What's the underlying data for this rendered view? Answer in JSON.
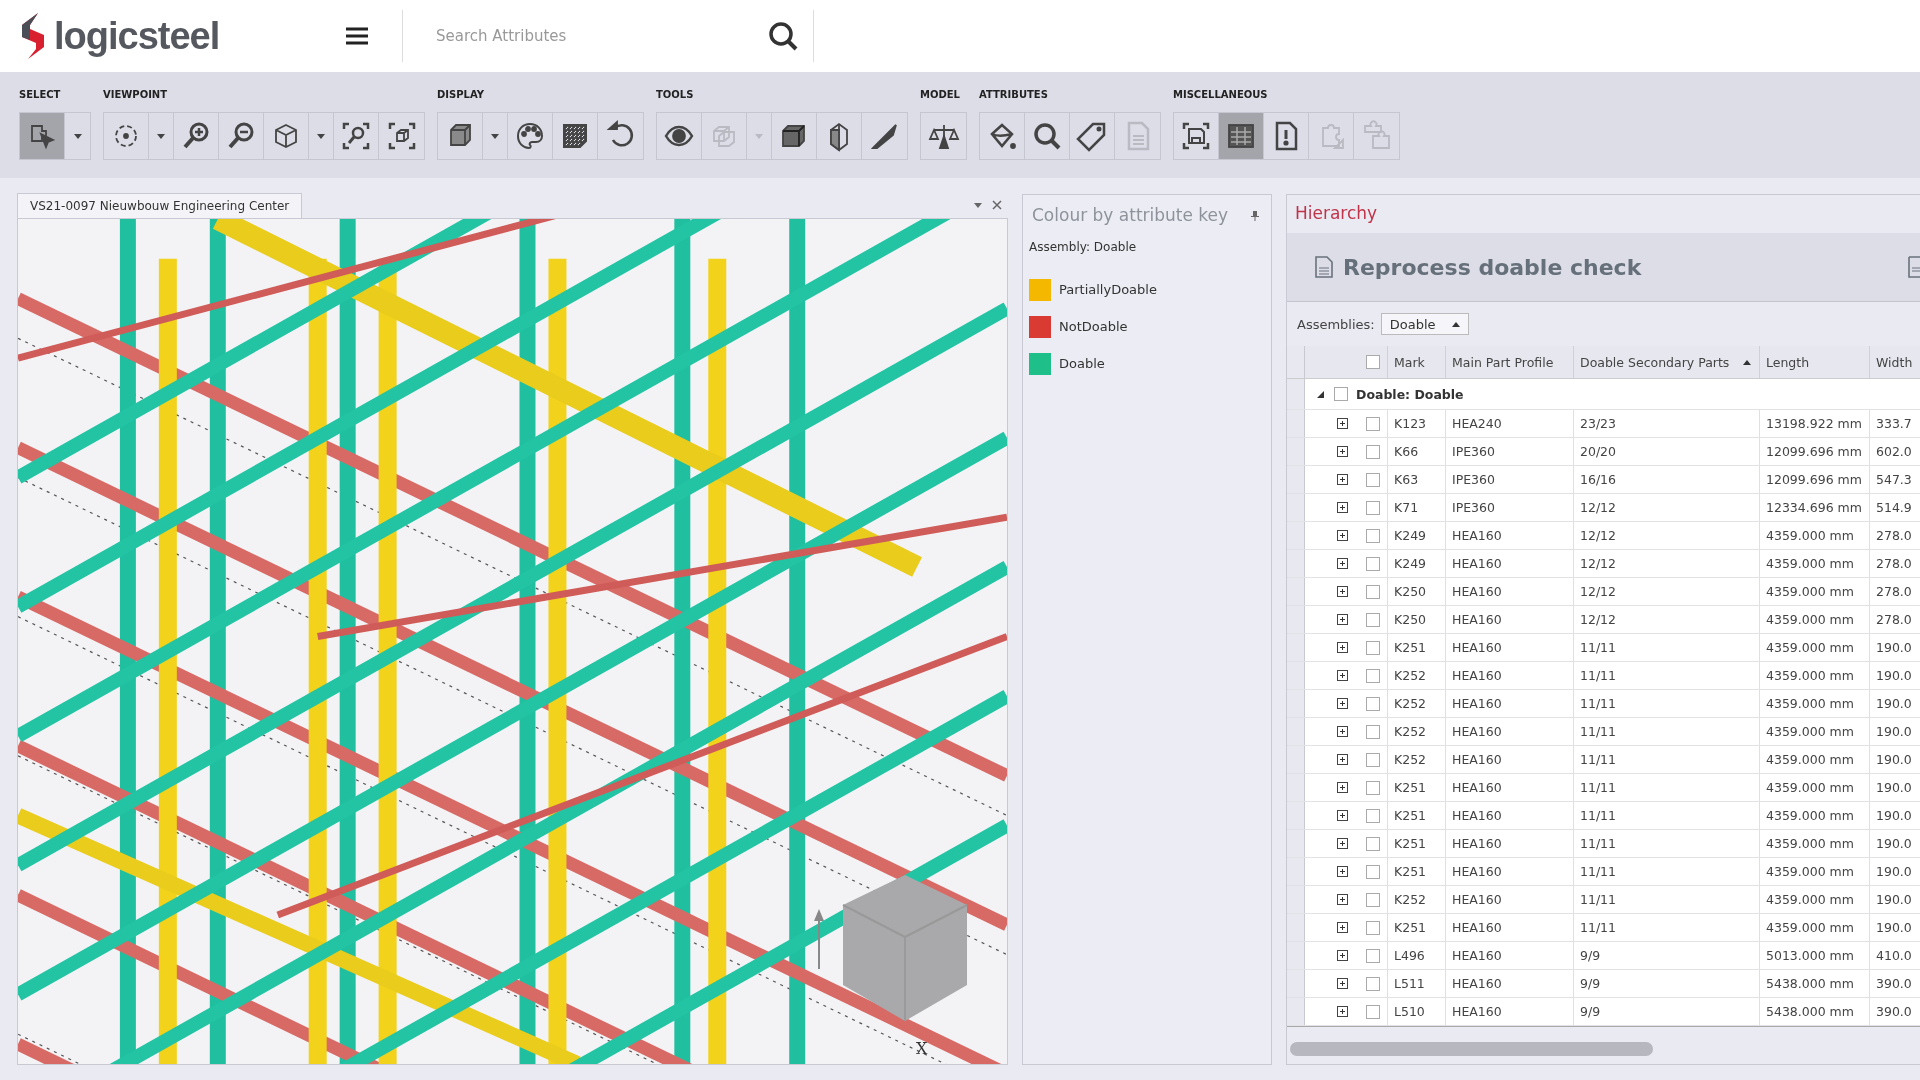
{
  "header": {
    "logo": "logicsteel",
    "search": {
      "placeholder": "Search Attributes"
    }
  },
  "toolbar": {
    "groups": [
      {
        "label": "SELECT",
        "buttons": [
          {
            "kind": "tool",
            "selected": true,
            "disabled": false
          },
          {
            "kind": "dropdown",
            "selected": false,
            "disabled": false
          }
        ]
      },
      {
        "label": "VIEWPOINT",
        "buttons": [
          {
            "kind": "tool",
            "selected": false,
            "disabled": false
          },
          {
            "kind": "dropdown",
            "selected": false,
            "disabled": false
          },
          {
            "kind": "tool",
            "selected": false,
            "disabled": false
          },
          {
            "kind": "tool",
            "selected": false,
            "disabled": false
          },
          {
            "kind": "tool",
            "selected": false,
            "disabled": false
          },
          {
            "kind": "dropdown",
            "selected": false,
            "disabled": false
          },
          {
            "kind": "tool",
            "selected": false,
            "disabled": false
          },
          {
            "kind": "tool",
            "selected": false,
            "disabled": false
          }
        ]
      },
      {
        "label": "DISPLAY",
        "buttons": [
          {
            "kind": "tool",
            "selected": false,
            "disabled": false
          },
          {
            "kind": "dropdown",
            "selected": false,
            "disabled": false
          },
          {
            "kind": "tool",
            "selected": false,
            "disabled": false
          },
          {
            "kind": "tool",
            "selected": false,
            "disabled": false
          },
          {
            "kind": "tool",
            "selected": false,
            "disabled": false
          }
        ]
      },
      {
        "label": "TOOLS",
        "buttons": [
          {
            "kind": "tool",
            "selected": false,
            "disabled": false
          },
          {
            "kind": "tool",
            "selected": false,
            "disabled": true
          },
          {
            "kind": "dropdown",
            "selected": false,
            "disabled": true
          },
          {
            "kind": "tool",
            "selected": false,
            "disabled": false
          },
          {
            "kind": "tool",
            "selected": false,
            "disabled": false
          },
          {
            "kind": "tool",
            "selected": false,
            "disabled": false
          }
        ]
      },
      {
        "label": "MODEL",
        "buttons": [
          {
            "kind": "tool",
            "selected": false,
            "disabled": false
          }
        ]
      },
      {
        "label": "ATTRIBUTES",
        "buttons": [
          {
            "kind": "tool",
            "selected": false,
            "disabled": false
          },
          {
            "kind": "tool",
            "selected": false,
            "disabled": false
          },
          {
            "kind": "tool",
            "selected": false,
            "disabled": false
          },
          {
            "kind": "tool",
            "selected": false,
            "disabled": true
          }
        ]
      },
      {
        "label": "MISCELLANEOUS",
        "buttons": [
          {
            "kind": "tool",
            "selected": false,
            "disabled": false
          },
          {
            "kind": "tool",
            "selected": true,
            "disabled": false
          },
          {
            "kind": "tool",
            "selected": false,
            "disabled": false
          },
          {
            "kind": "tool",
            "selected": false,
            "disabled": true
          },
          {
            "kind": "tool",
            "selected": false,
            "disabled": true
          }
        ]
      }
    ]
  },
  "viewport": {
    "tab": "VS21-0097 Nieuwbouw Engineering Center",
    "axis_label": "X"
  },
  "legend": {
    "title": "Colour by attribute key",
    "subtitle": "Assembly: Doable",
    "items": [
      {
        "label": "PartiallyDoable",
        "color": "#f5b800"
      },
      {
        "label": "NotDoable",
        "color": "#d93a32"
      },
      {
        "label": "Doable",
        "color": "#1fbf8a"
      }
    ]
  },
  "hierarchy": {
    "title": "Hierarchy",
    "heading": "Reprocess doable check",
    "filter": {
      "label": "Assemblies:",
      "value": "Doable"
    },
    "table": {
      "header_checked": false,
      "columns": [
        {
          "label": "Mark",
          "sorted": false
        },
        {
          "label": "Main Part Profile",
          "sorted": false
        },
        {
          "label": "Doable Secondary Parts",
          "sorted": true
        },
        {
          "label": "Length",
          "sorted": false
        },
        {
          "label": "Width"
        }
      ],
      "group": {
        "label": "Doable: Doable",
        "expanded": true,
        "checked": false
      },
      "rows": [
        {
          "cells": [
            "K123",
            "HEA240",
            "23/23",
            "13198.922 mm",
            "333.7"
          ],
          "expanded": false,
          "checked": false
        },
        {
          "cells": [
            "K66",
            "IPE360",
            "20/20",
            "12099.696 mm",
            "602.0"
          ],
          "expanded": false,
          "checked": false
        },
        {
          "cells": [
            "K63",
            "IPE360",
            "16/16",
            "12099.696 mm",
            "547.3"
          ],
          "expanded": false,
          "checked": false
        },
        {
          "cells": [
            "K71",
            "IPE360",
            "12/12",
            "12334.696 mm",
            "514.9"
          ],
          "expanded": false,
          "checked": false
        },
        {
          "cells": [
            "K249",
            "HEA160",
            "12/12",
            "4359.000 mm",
            "278.0"
          ],
          "expanded": false,
          "checked": false
        },
        {
          "cells": [
            "K249",
            "HEA160",
            "12/12",
            "4359.000 mm",
            "278.0"
          ],
          "expanded": false,
          "checked": false
        },
        {
          "cells": [
            "K250",
            "HEA160",
            "12/12",
            "4359.000 mm",
            "278.0"
          ],
          "expanded": false,
          "checked": false
        },
        {
          "cells": [
            "K250",
            "HEA160",
            "12/12",
            "4359.000 mm",
            "278.0"
          ],
          "expanded": false,
          "checked": false
        },
        {
          "cells": [
            "K251",
            "HEA160",
            "11/11",
            "4359.000 mm",
            "190.0"
          ],
          "expanded": false,
          "checked": false
        },
        {
          "cells": [
            "K252",
            "HEA160",
            "11/11",
            "4359.000 mm",
            "190.0"
          ],
          "expanded": false,
          "checked": false
        },
        {
          "cells": [
            "K252",
            "HEA160",
            "11/11",
            "4359.000 mm",
            "190.0"
          ],
          "expanded": false,
          "checked": false
        },
        {
          "cells": [
            "K252",
            "HEA160",
            "11/11",
            "4359.000 mm",
            "190.0"
          ],
          "expanded": false,
          "checked": false
        },
        {
          "cells": [
            "K252",
            "HEA160",
            "11/11",
            "4359.000 mm",
            "190.0"
          ],
          "expanded": false,
          "checked": false
        },
        {
          "cells": [
            "K251",
            "HEA160",
            "11/11",
            "4359.000 mm",
            "190.0"
          ],
          "expanded": false,
          "checked": false
        },
        {
          "cells": [
            "K251",
            "HEA160",
            "11/11",
            "4359.000 mm",
            "190.0"
          ],
          "expanded": false,
          "checked": false
        },
        {
          "cells": [
            "K251",
            "HEA160",
            "11/11",
            "4359.000 mm",
            "190.0"
          ],
          "expanded": false,
          "checked": false
        },
        {
          "cells": [
            "K251",
            "HEA160",
            "11/11",
            "4359.000 mm",
            "190.0"
          ],
          "expanded": false,
          "checked": false
        },
        {
          "cells": [
            "K252",
            "HEA160",
            "11/11",
            "4359.000 mm",
            "190.0"
          ],
          "expanded": false,
          "checked": false
        },
        {
          "cells": [
            "K251",
            "HEA160",
            "11/11",
            "4359.000 mm",
            "190.0"
          ],
          "expanded": false,
          "checked": false
        },
        {
          "cells": [
            "L496",
            "HEA160",
            "9/9",
            "5013.000 mm",
            "410.0"
          ],
          "expanded": false,
          "checked": false
        },
        {
          "cells": [
            "L511",
            "HEA160",
            "9/9",
            "5438.000 mm",
            "390.0"
          ],
          "expanded": false,
          "checked": false
        },
        {
          "cells": [
            "L510",
            "HEA160",
            "9/9",
            "5438.000 mm",
            "390.0"
          ],
          "expanded": false,
          "checked": false
        }
      ]
    }
  }
}
